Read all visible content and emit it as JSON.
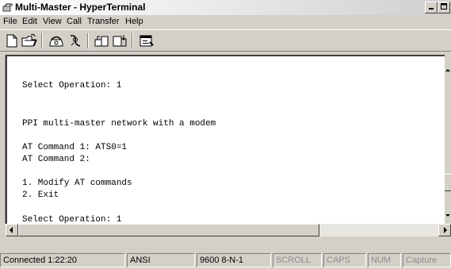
{
  "window": {
    "title": "Multi-Master - HyperTerminal"
  },
  "menu": [
    "File",
    "Edit",
    "View",
    "Call",
    "Transfer",
    "Help"
  ],
  "toolbar_icons": [
    "new-document-icon",
    "open-folder-icon",
    "call-icon",
    "disconnect-icon",
    "send-icon",
    "receive-icon",
    "properties-icon"
  ],
  "terminal": {
    "lines": [
      "Select Operation: 1",
      "PPI multi-master network with a modem",
      "AT Command 1: ATS0=1",
      "AT Command 2:",
      "1. Modify AT commands",
      "2. Exit",
      "Select Operation: 1"
    ]
  },
  "status": {
    "connected": "Connected 1:22:20",
    "emulation": "ANSI",
    "settings": "9600 8-N-1",
    "scroll": "SCROLL",
    "caps": "CAPS",
    "num": "NUM",
    "capture": "Capture"
  }
}
